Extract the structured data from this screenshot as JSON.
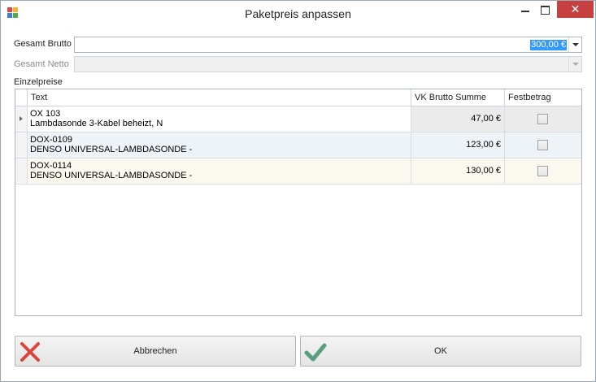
{
  "window": {
    "title": "Paketpreis anpassen",
    "close_glyph": "✕"
  },
  "form": {
    "gesamt_brutto_label": "Gesamt Brutto",
    "gesamt_brutto_value": "300,00 €",
    "gesamt_netto_label": "Gesamt Netto",
    "gesamt_netto_value": "",
    "einzelpreise_label": "Einzelpreise"
  },
  "grid": {
    "columns": [
      "Text",
      "VK Brutto Summe",
      "Festbetrag"
    ],
    "rows": [
      {
        "line1": "OX 103",
        "line2": "Lambdasonde 3-Kabel beheizt, N",
        "sum": "47,00 €",
        "festbetrag": false
      },
      {
        "line1": "DOX-0109",
        "line2": "DENSO UNIVERSAL-LAMBDASONDE -",
        "sum": "123,00 €",
        "festbetrag": false
      },
      {
        "line1": "DOX-0114",
        "line2": "DENSO UNIVERSAL-LAMBDASONDE -",
        "sum": "130,00 €",
        "festbetrag": false
      }
    ]
  },
  "buttons": {
    "cancel_label": "Abbrechen",
    "ok_label": "OK"
  },
  "colors": {
    "cancel_icon": "#d9473b",
    "ok_icon": "#5a9e7b",
    "selection": "#3399ff",
    "close": "#c74040"
  },
  "icons": {
    "app": "app-icon",
    "cancel": "cross-icon",
    "ok": "checkmark-icon"
  }
}
